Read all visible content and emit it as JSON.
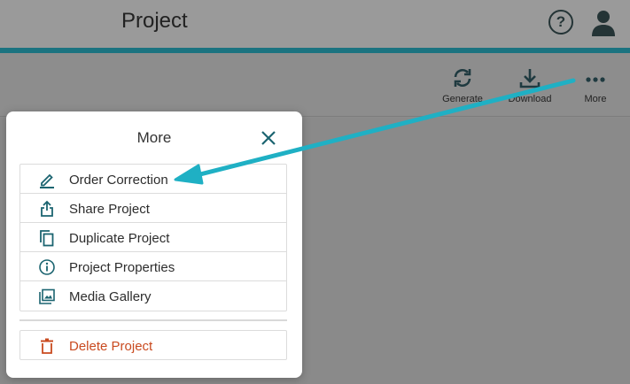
{
  "header": {
    "title": "Project",
    "help_icon": "question-circle-icon",
    "avatar_icon": "user-icon",
    "accent_color": "#1b7380"
  },
  "toolbar": {
    "items": [
      {
        "label": "Generate",
        "icon": "refresh-icon"
      },
      {
        "label": "Download",
        "icon": "download-icon"
      },
      {
        "label": "More",
        "icon": "more-dots-icon"
      }
    ]
  },
  "modal": {
    "title": "More",
    "close_icon": "close-icon",
    "items": [
      {
        "label": "Order Correction",
        "icon": "pencil-icon"
      },
      {
        "label": "Share Project",
        "icon": "share-icon"
      },
      {
        "label": "Duplicate Project",
        "icon": "copy-icon"
      },
      {
        "label": "Project Properties",
        "icon": "info-icon"
      },
      {
        "label": "Media Gallery",
        "icon": "image-gallery-icon"
      }
    ],
    "delete": {
      "label": "Delete Project",
      "icon": "trash-icon",
      "color": "#c94a1f"
    },
    "icon_color": "#1b6470"
  },
  "annotation": {
    "arrow_color": "#1fb0c4"
  }
}
